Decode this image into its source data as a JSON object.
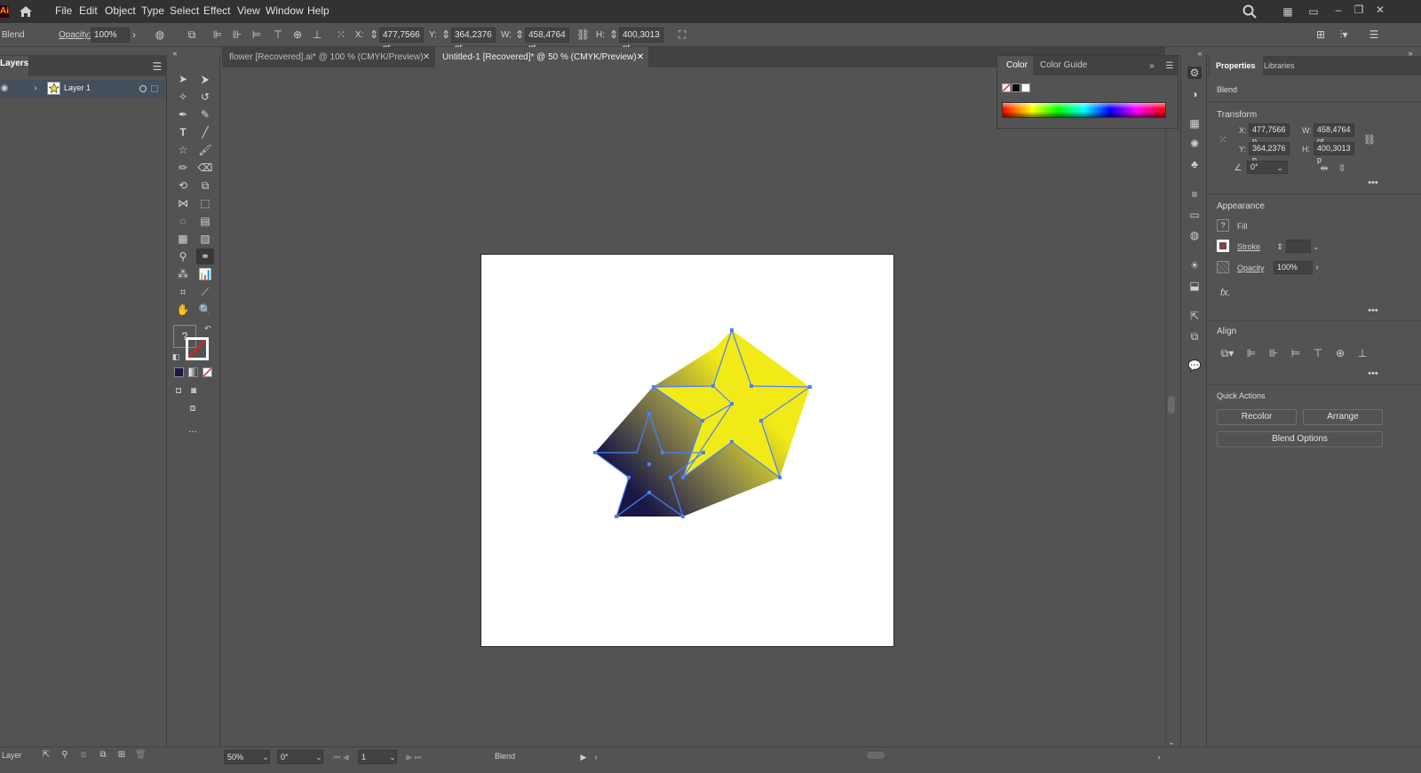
{
  "app": {
    "logo": "Ai"
  },
  "menu": [
    "File",
    "Edit",
    "Object",
    "Type",
    "Select",
    "Effect",
    "View",
    "Window",
    "Help"
  ],
  "control_bar": {
    "selection_type": "Blend",
    "opacity_label": "Opacity:",
    "opacity_value": "100%",
    "x_label": "X:",
    "x_value": "477,7566 pt",
    "y_label": "Y:",
    "y_value": "364,2376 pt",
    "w_label": "W:",
    "w_value": "458,4764 pt",
    "h_label": "H:",
    "h_value": "400,3013 pt"
  },
  "layers_panel": {
    "title": "Layers",
    "layer_name": "Layer 1"
  },
  "document_tabs": [
    {
      "label": "flower [Recovered].ai* @ 100 % (CMYK/Preview)",
      "active": false
    },
    {
      "label": "Untitled-1 [Recovered]* @ 50 % (CMYK/Preview)",
      "active": true
    }
  ],
  "color_panel": {
    "tabs": [
      "Color",
      "Color Guide"
    ]
  },
  "properties_panel": {
    "tabs": [
      "Properties",
      "Libraries"
    ],
    "selection": "Blend",
    "transform": {
      "title": "Transform",
      "x_label": "X:",
      "x_value": "477,7566 p",
      "y_label": "Y:",
      "y_value": "364,2376 p",
      "w_label": "W:",
      "w_value": "458,4764 pt",
      "h_label": "H:",
      "h_value": "400,3013 p",
      "angle_value": "0°"
    },
    "appearance": {
      "title": "Appearance",
      "fill_label": "Fill",
      "stroke_label": "Stroke",
      "opacity_label": "Opacity",
      "opacity_value": "100%",
      "fx_label": "fx."
    },
    "align": {
      "title": "Align"
    },
    "quick_actions": {
      "title": "Quick Actions",
      "recolor": "Recolor",
      "arrange": "Arrange",
      "blend_options": "Blend Options"
    }
  },
  "tools": {
    "more": "...",
    "question": "?"
  },
  "status_bar": {
    "zoom": "50%",
    "rotation": "0°",
    "artboard": "1",
    "mode": "Blend",
    "layer_label": "Layer"
  },
  "colors": {
    "star_yellow": "#f2ea16",
    "star_navy": "#181745",
    "selection_blue": "#4a7fff",
    "panel_bg": "#535353",
    "menu_bg": "#323232"
  }
}
